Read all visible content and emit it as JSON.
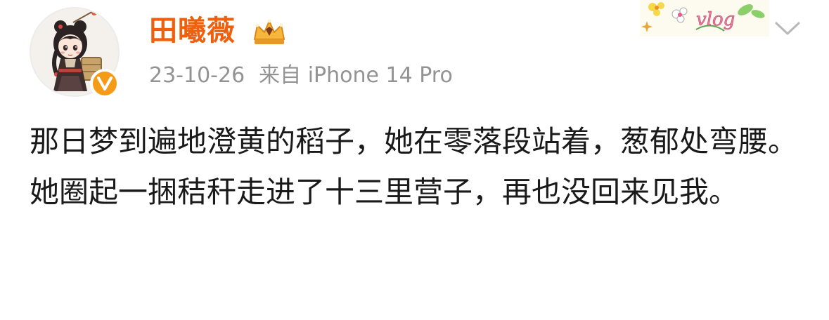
{
  "user": {
    "name": "田曦薇",
    "avatar_icon": "anime-girl-avatar",
    "verified_icon": "verified-v-icon",
    "member_badge_icon": "crown-badge-icon"
  },
  "meta": {
    "date": "23-10-26",
    "source": "来自 iPhone 14 Pro"
  },
  "decoration": {
    "label": "vlog"
  },
  "actions": {
    "more_icon": "chevron-down-icon"
  },
  "post": {
    "paragraph_1": "那日梦到遍地澄黄的稻子，她在零落段站着，葱郁处弯腰。",
    "paragraph_2": "她圈起一捆秸秆走进了十三里营子，再也没回来见我。"
  },
  "colors": {
    "name": "#f0600c",
    "meta": "#939393",
    "text": "#1a1a1a",
    "verified": "#f59b18"
  }
}
